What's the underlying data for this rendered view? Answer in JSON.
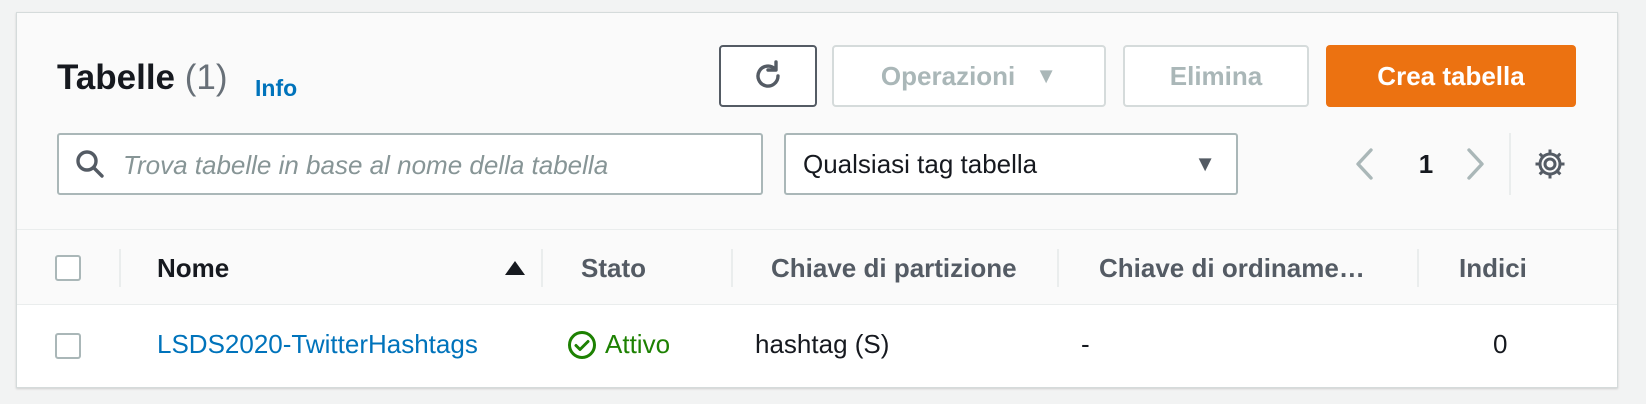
{
  "header": {
    "title": "Tabelle",
    "count": "(1)",
    "info_label": "Info"
  },
  "actions": {
    "operations_label": "Operazioni",
    "delete_label": "Elimina",
    "create_label": "Crea tabella"
  },
  "search": {
    "placeholder": "Trova tabelle in base al nome della tabella",
    "value": ""
  },
  "tag_filter": {
    "selected": "Qualsiasi tag tabella"
  },
  "pagination": {
    "current_page": "1"
  },
  "table": {
    "columns": [
      "Nome",
      "Stato",
      "Chiave di partizione",
      "Chiave di ordiname…",
      "Indici"
    ],
    "sort_column": "Nome",
    "sort_direction": "ascending",
    "rows": [
      {
        "name": "LSDS2020-TwitterHashtags",
        "status": "Attivo",
        "partition_key": "hashtag (S)",
        "sort_key": "-",
        "indexes": "0"
      }
    ]
  },
  "colors": {
    "primary": "#ec7211",
    "link": "#0073bb",
    "success": "#1d8102",
    "disabled": "#aab7b8"
  },
  "icons": [
    "refresh-icon",
    "caret-down-icon",
    "search-icon",
    "chevron-left-icon",
    "chevron-right-icon",
    "gear-icon",
    "sort-ascending-icon",
    "status-ok-icon"
  ]
}
